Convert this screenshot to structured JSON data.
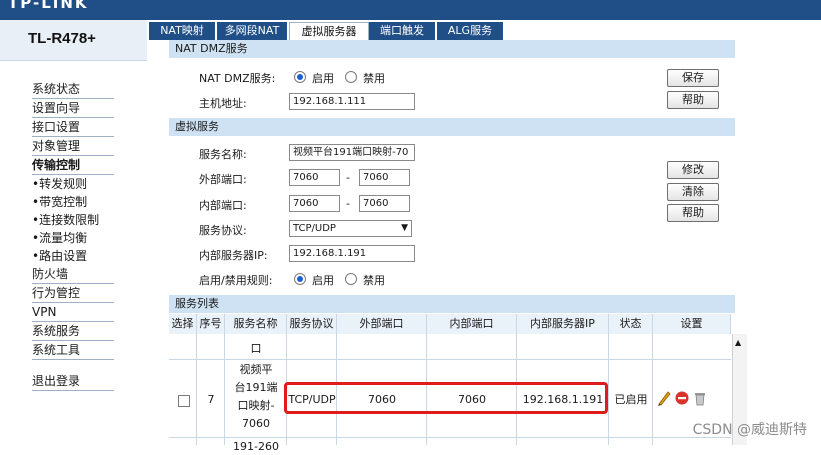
{
  "banner": {
    "brand": "TP-LINK"
  },
  "sidebar": {
    "model": "TL-R478+",
    "items": [
      {
        "label": "系统状态",
        "type": "item"
      },
      {
        "label": "设置向导",
        "type": "item"
      },
      {
        "label": "接口设置",
        "type": "item"
      },
      {
        "label": "对象管理",
        "type": "item"
      },
      {
        "label": "传输控制",
        "type": "item-bold"
      },
      {
        "label": "•转发规则",
        "type": "sub-active"
      },
      {
        "label": "•带宽控制",
        "type": "sub"
      },
      {
        "label": "•连接数限制",
        "type": "sub"
      },
      {
        "label": "•流量均衡",
        "type": "sub"
      },
      {
        "label": "•路由设置",
        "type": "sub"
      },
      {
        "label": "防火墙",
        "type": "item"
      },
      {
        "label": "行为管控",
        "type": "item"
      },
      {
        "label": "VPN",
        "type": "item"
      },
      {
        "label": "系统服务",
        "type": "item"
      },
      {
        "label": "系统工具",
        "type": "item"
      }
    ],
    "logout": "退出登录"
  },
  "tabs": [
    {
      "label": "NAT映射"
    },
    {
      "label": "多网段NAT"
    },
    {
      "label": "虚拟服务器",
      "active": true
    },
    {
      "label": "端口触发"
    },
    {
      "label": "ALG服务"
    }
  ],
  "dmz": {
    "header": "NAT DMZ服务",
    "service_label": "NAT DMZ服务:",
    "enable_label": "启用",
    "disable_label": "禁用",
    "host_label": "主机地址:",
    "host_value": "192.168.1.111",
    "save_button": "保存",
    "help_button": "帮助"
  },
  "virtual": {
    "header": "虚拟服务",
    "name_label": "服务名称:",
    "name_value": "视频平台191端口映射-70",
    "ext_port_label": "外部端口:",
    "ext_port_from": "7060",
    "ext_port_to": "7060",
    "int_port_label": "内部端口:",
    "int_port_from": "7060",
    "int_port_to": "7060",
    "dash": "-",
    "protocol_label": "服务协议:",
    "protocol_value": "TCP/UDP",
    "server_ip_label": "内部服务器IP:",
    "server_ip_value": "192.168.1.191",
    "rule_label": "启用/禁用规则:",
    "enable_label": "启用",
    "disable_label": "禁用",
    "modify_button": "修改",
    "clear_button": "清除",
    "help_button": "帮助"
  },
  "list": {
    "header": "服务列表",
    "columns": [
      "选择",
      "序号",
      "服务名称",
      "服务协议",
      "外部端口",
      "内部端口",
      "内部服务器IP",
      "状态",
      "设置"
    ],
    "prev_row_tail": "口",
    "row": {
      "index": "7",
      "name_lines": [
        "视频平",
        "台191端",
        "口映射-",
        "7060"
      ],
      "protocol": "TCP/UDP",
      "ext_port": "7060",
      "int_port": "7060",
      "server_ip": "192.168.1.191",
      "status": "已启用"
    },
    "next_row_head": "191-260"
  },
  "watermark": "CSDN @威迪斯特"
}
